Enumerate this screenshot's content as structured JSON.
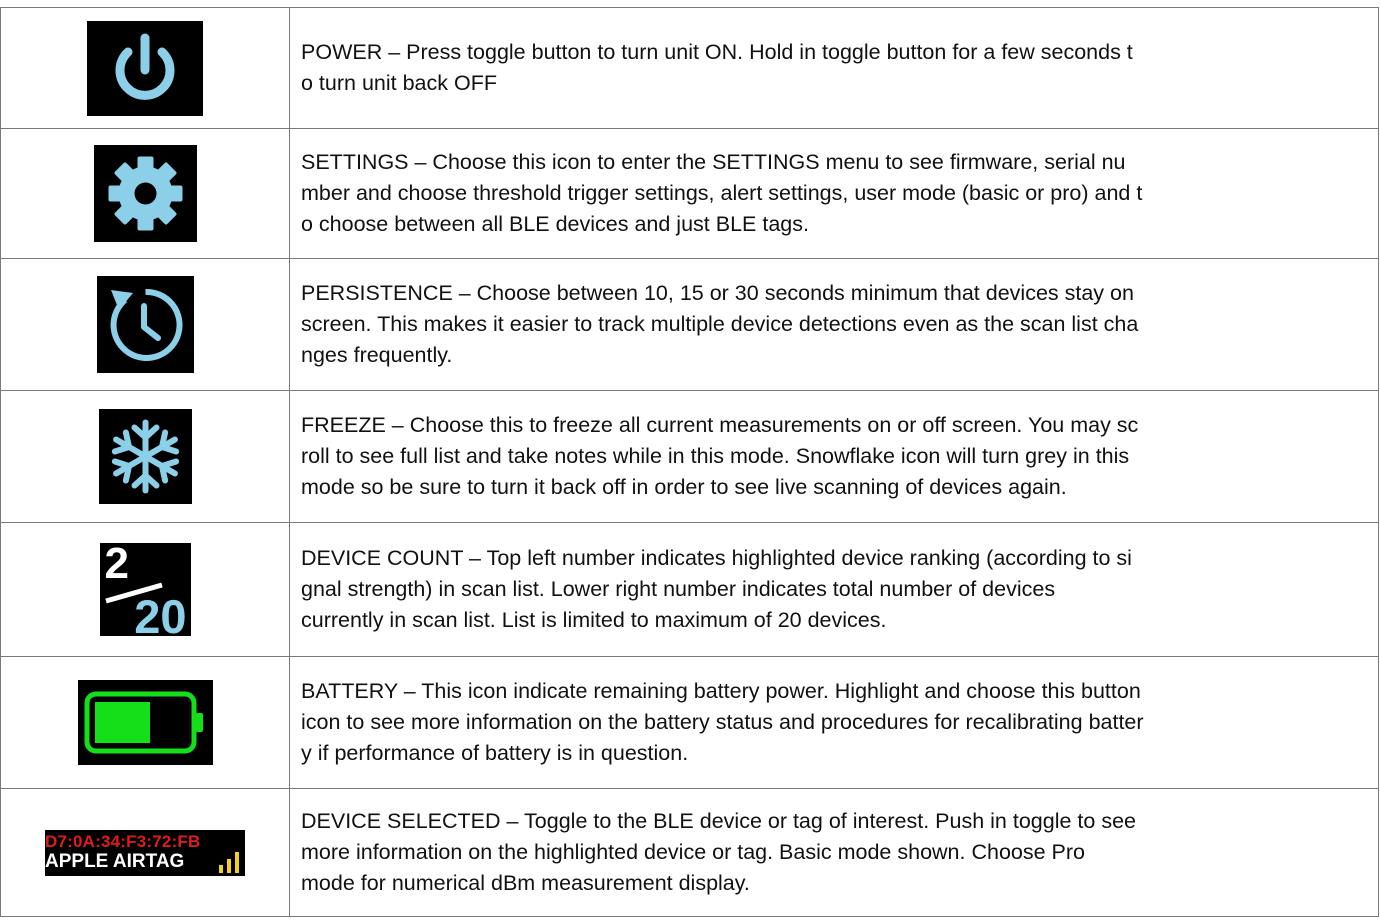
{
  "rows": [
    {
      "icon": "power-icon",
      "description": "POWER – Press toggle button to turn unit ON. Hold in toggle button for a few seconds t\no turn unit back OFF"
    },
    {
      "icon": "gear-icon",
      "description": "SETTINGS – Choose this icon to enter the SETTINGS menu to see firmware, serial nu\nmber and choose threshold trigger settings, alert settings, user mode (basic or pro) and t\no choose between all BLE devices and just BLE tags."
    },
    {
      "icon": "clock-refresh-icon",
      "description": "PERSISTENCE – Choose between 10, 15 or 30 seconds minimum that devices stay on\nscreen. This makes it easier to track multiple device detections even as the scan list cha\nnges frequently."
    },
    {
      "icon": "snowflake-icon",
      "description": "FREEZE – Choose this to freeze all current measurements on or off screen. You may sc\nroll to see full list and take notes while in this mode. Snowflake icon will turn grey in this\nmode so be sure to turn it back off in order to see live scanning of devices again."
    },
    {
      "icon": "device-count-icon",
      "count_top": "2",
      "count_bottom": "20",
      "description": "DEVICE COUNT – Top left number indicates highlighted device ranking (according to si\ngnal strength) in scan list. Lower right number indicates total number of devices\ncurrently in scan list. List is limited to maximum of 20 devices."
    },
    {
      "icon": "battery-icon",
      "battery_level": 0.6,
      "description": "BATTERY – This icon indicate remaining battery power. Highlight and choose this button\nicon to see more information on the battery status and procedures for recalibrating batter\ny if performance of battery is in question."
    },
    {
      "icon": "device-selected-icon",
      "device_mac": "D7:0A:34:F3:72:FB",
      "device_name": "APPLE AIRTAG",
      "signal_bars": 3,
      "description": " DEVICE SELECTED – Toggle to the BLE device or tag of interest. Push in toggle to see\nmore information on the highlighted device or tag. Basic mode shown. Choose Pro\nmode for numerical dBm measurement display."
    }
  ],
  "colors": {
    "icon_blue": "#8ccfe8",
    "battery_green": "#14e01a",
    "mac_red": "#e01b1b",
    "signal_yellow": "#f2d21b"
  }
}
